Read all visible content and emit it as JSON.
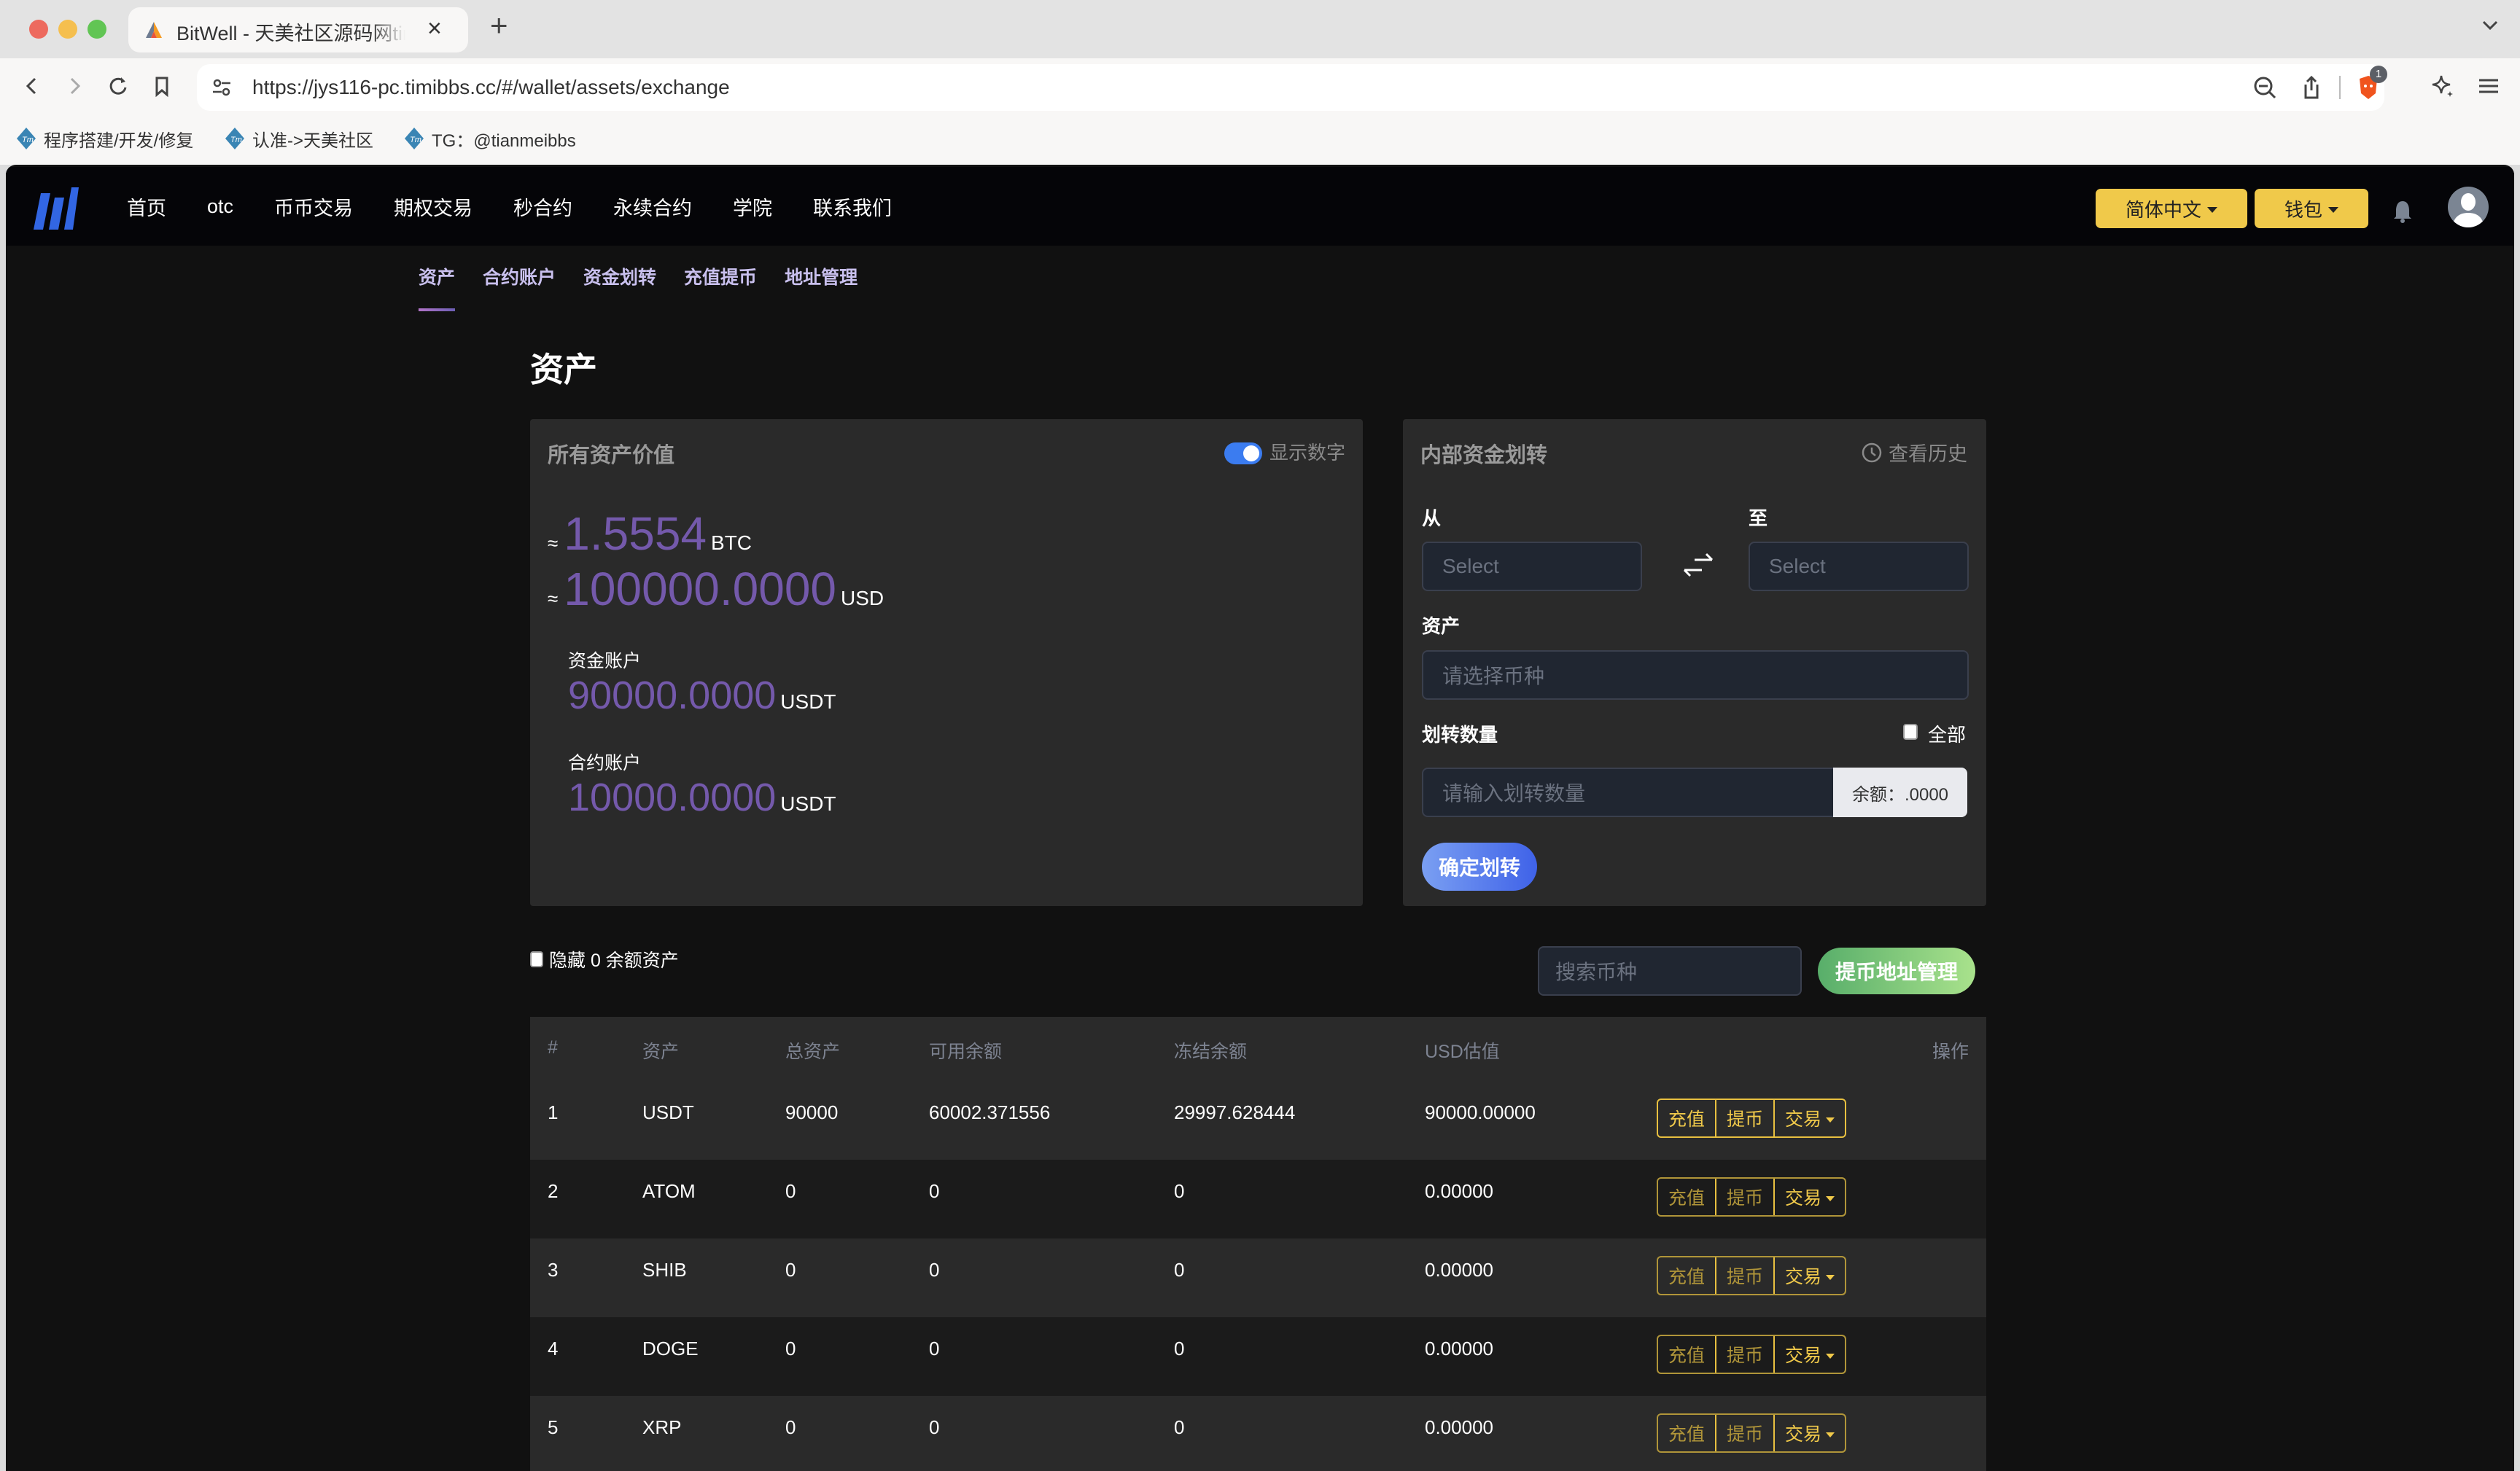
{
  "browser": {
    "tab_title": "BitWell - 天美社区源码网timibbs",
    "url": "https://jys116-pc.timibbs.cc/#/wallet/assets/exchange",
    "new_tab_label": "+",
    "close_tab_label": "×",
    "brave_badge_count": "1",
    "bookmarks": [
      {
        "label": "程序搭建/开发/修复"
      },
      {
        "label": "认准->天美社区"
      },
      {
        "label": "TG：@tianmeibbs"
      }
    ]
  },
  "header": {
    "nav": [
      {
        "label": "首页"
      },
      {
        "label": "otc"
      },
      {
        "label": "币币交易"
      },
      {
        "label": "期权交易"
      },
      {
        "label": "秒合约"
      },
      {
        "label": "永续合约"
      },
      {
        "label": "学院"
      },
      {
        "label": "联系我们"
      }
    ],
    "language_label": "简体中文",
    "wallet_label": "钱包",
    "accent_color": "#f0c94a"
  },
  "subnav": {
    "items": [
      {
        "label": "资产",
        "active": true
      },
      {
        "label": "合约账户"
      },
      {
        "label": "资金划转"
      },
      {
        "label": "充值提币"
      },
      {
        "label": "地址管理"
      }
    ]
  },
  "page": {
    "title": "资产"
  },
  "assets_card": {
    "title": "所有资产价值",
    "show_numbers_label": "显示数字",
    "show_numbers_on": true,
    "approx_symbol": "≈",
    "btc_value": "1.5554",
    "btc_unit": "BTC",
    "usd_value": "100000.0000",
    "usd_unit": "USD",
    "funding_label": "资金账户",
    "funding_value": "90000.0000",
    "funding_unit": "USDT",
    "contract_label": "合约账户",
    "contract_value": "10000.0000",
    "contract_unit": "USDT",
    "value_color": "#7459ab"
  },
  "transfer_card": {
    "title": "内部资金划转",
    "history_label": "查看历史",
    "from_label": "从",
    "to_label": "至",
    "from_placeholder": "Select",
    "to_placeholder": "Select",
    "asset_label": "资产",
    "asset_placeholder": "请选择币种",
    "amount_label": "划转数量",
    "all_label": "全部",
    "amount_placeholder": "请输入划转数量",
    "balance_text": "余额：.0000",
    "confirm_label": "确定划转"
  },
  "list_controls": {
    "hide_zero_label": "隐藏 0 余额资产",
    "search_placeholder": "搜索币种",
    "address_mgmt_label": "提币地址管理"
  },
  "table": {
    "columns": [
      "#",
      "资产",
      "总资产",
      "可用余额",
      "冻结余额",
      "USD估值",
      "操作"
    ],
    "action_labels": {
      "deposit": "充值",
      "withdraw": "提币",
      "trade": "交易"
    },
    "rows": [
      {
        "index": "1",
        "asset": "USDT",
        "total": "90000",
        "available": "60002.371556",
        "frozen": "29997.628444",
        "usd": "90000.00000",
        "enabled": true
      },
      {
        "index": "2",
        "asset": "ATOM",
        "total": "0",
        "available": "0",
        "frozen": "0",
        "usd": "0.00000",
        "enabled": false
      },
      {
        "index": "3",
        "asset": "SHIB",
        "total": "0",
        "available": "0",
        "frozen": "0",
        "usd": "0.00000",
        "enabled": false
      },
      {
        "index": "4",
        "asset": "DOGE",
        "total": "0",
        "available": "0",
        "frozen": "0",
        "usd": "0.00000",
        "enabled": false
      },
      {
        "index": "5",
        "asset": "XRP",
        "total": "0",
        "available": "0",
        "frozen": "0",
        "usd": "0.00000",
        "enabled": false
      }
    ]
  }
}
